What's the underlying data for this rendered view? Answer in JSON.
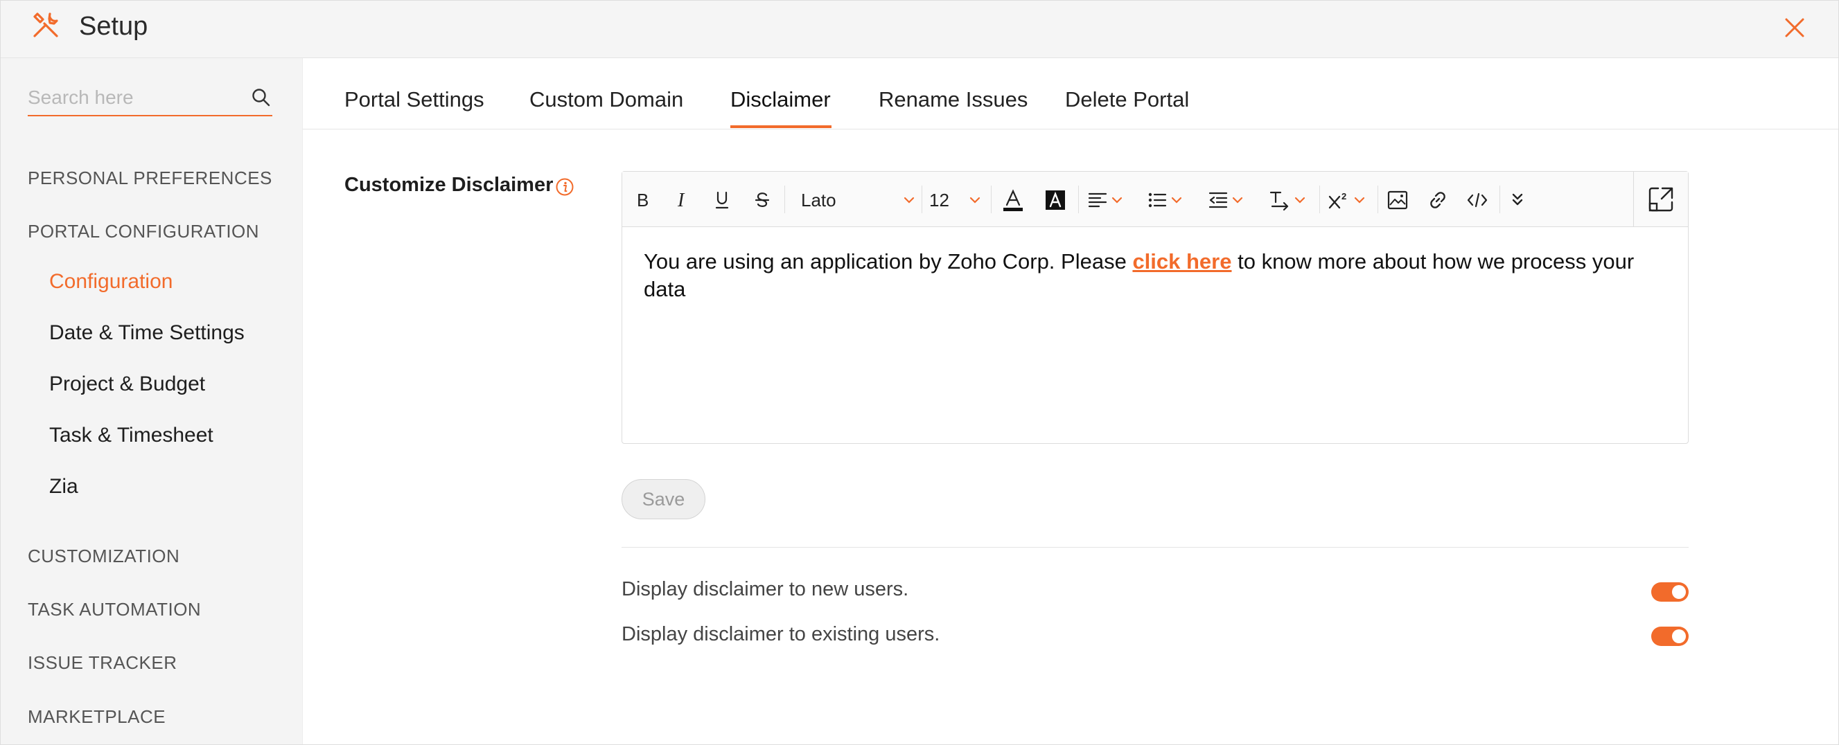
{
  "header": {
    "title": "Setup"
  },
  "colors": {
    "accent": "#f26b2b",
    "sidebar_bg": "#f4f4f4",
    "header_bg": "#f5f5f5"
  },
  "sidebar": {
    "search_placeholder": "Search here",
    "sections": {
      "personal_preferences": "PERSONAL PREFERENCES",
      "portal_configuration": "PORTAL CONFIGURATION",
      "customization": "CUSTOMIZATION",
      "task_automation": "TASK AUTOMATION",
      "issue_tracker": "ISSUE TRACKER",
      "marketplace": "MARKETPLACE"
    },
    "items": {
      "configuration": "Configuration",
      "date_time": "Date & Time Settings",
      "project_budget": "Project & Budget",
      "task_timesheet": "Task & Timesheet",
      "zia": "Zia"
    },
    "active_item": "Configuration"
  },
  "tabs": {
    "portal_settings": "Portal Settings",
    "custom_domain": "Custom Domain",
    "disclaimer": "Disclaimer",
    "rename_issues": "Rename Issues",
    "delete_portal": "Delete Portal",
    "active": "Disclaimer"
  },
  "disclaimer": {
    "label": "Customize Disclaimer",
    "toolbar": {
      "font": "Lato",
      "size": "12"
    },
    "text_before": "You are using an application by Zoho Corp. Please ",
    "link_text": "click here",
    "text_after": " to know more about how we process your data",
    "save_label": "Save",
    "options": {
      "new_users": {
        "label": "Display disclaimer to new users.",
        "enabled": true
      },
      "existing_users": {
        "label": "Display disclaimer to existing users.",
        "enabled": true
      }
    }
  },
  "icons": [
    "tools-icon",
    "close-icon",
    "search-icon",
    "info-icon",
    "bold-icon",
    "italic-icon",
    "underline-icon",
    "strikethrough-icon",
    "font-color-icon",
    "highlight-icon",
    "align-icon",
    "list-icon",
    "indent-icon",
    "text-direction-icon",
    "superscript-icon",
    "image-icon",
    "link-icon",
    "code-icon",
    "more-icon",
    "expand-icon"
  ]
}
